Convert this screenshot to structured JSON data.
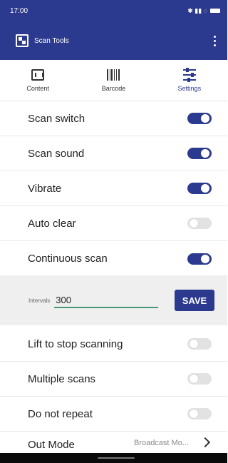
{
  "status_bar": {
    "time": "17:00",
    "indicators": "✱ ▮▮ ◌"
  },
  "app_bar": {
    "title": "Scan Tools",
    "app_icon": "qr-code-icon",
    "menu_icon": "more-vert-icon"
  },
  "tabs": [
    {
      "label": "Content",
      "icon": "scan-frame-icon",
      "active": false
    },
    {
      "label": "Barcode",
      "icon": "barcode-icon",
      "active": false
    },
    {
      "label": "Settings",
      "icon": "sliders-icon",
      "active": true
    }
  ],
  "settings": [
    {
      "label": "Scan switch",
      "on": true
    },
    {
      "label": "Scan sound",
      "on": true
    },
    {
      "label": "Vibrate",
      "on": true
    },
    {
      "label": "Auto clear",
      "on": false
    },
    {
      "label": "Continuous scan",
      "on": true
    }
  ],
  "interval": {
    "label": "Intervals",
    "value": "300",
    "save_label": "SAVE"
  },
  "settings_more": [
    {
      "label": "Lift to stop scanning",
      "on": false
    },
    {
      "label": "Multiple scans",
      "on": false
    },
    {
      "label": "Do not repeat",
      "on": false
    }
  ],
  "out_mode": {
    "label": "Out Mode",
    "value": "Broadcast Mo..."
  },
  "colors": {
    "primary": "#2b3a8e",
    "toggle_off": "#e2e2e2",
    "input_underline": "#4a9a7a"
  }
}
